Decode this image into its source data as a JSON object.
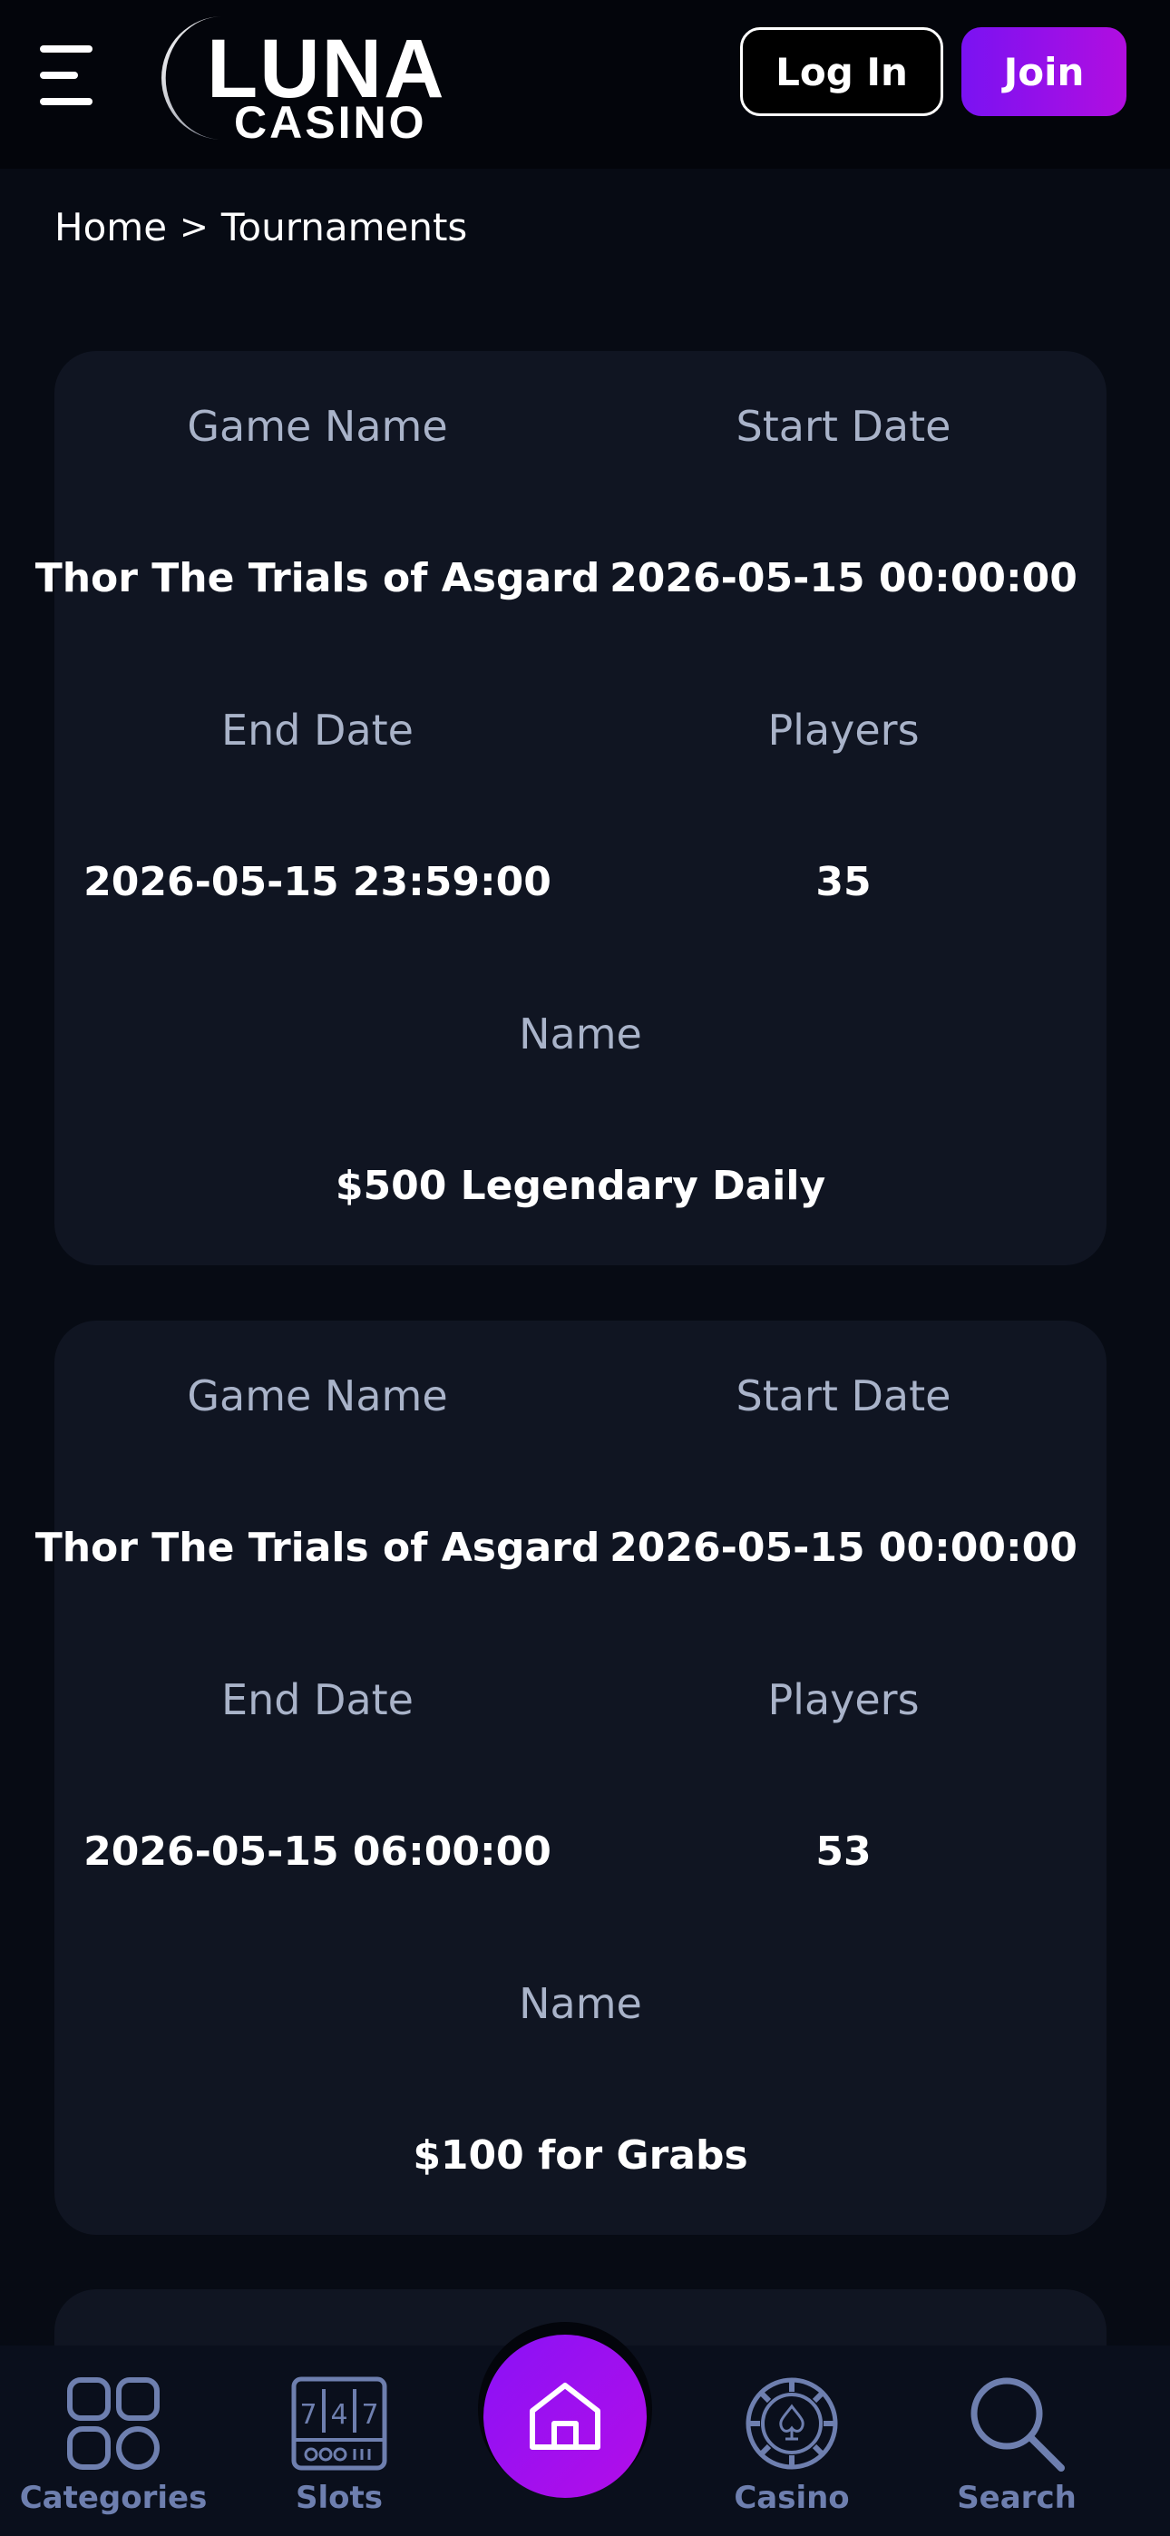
{
  "header": {
    "logo_word": "LUNA",
    "logo_sub": "CASINO",
    "login_label": "Log In",
    "join_label": "Join"
  },
  "breadcrumb": {
    "home": "Home",
    "separator": ">",
    "current": "Tournaments"
  },
  "labels": {
    "game_name": "Game Name",
    "start_date": "Start Date",
    "end_date": "End Date",
    "players": "Players",
    "name": "Name"
  },
  "tournaments": [
    {
      "game_name": "Thor The Trials of Asgard",
      "start_date": "2026-05-15 00:00:00",
      "end_date": "2026-05-15 23:59:00",
      "players": "35",
      "name": "$500 Legendary Daily"
    },
    {
      "game_name": "Thor The Trials of Asgard",
      "start_date": "2026-05-15 00:00:00",
      "end_date": "2026-05-15 06:00:00",
      "players": "53",
      "name": "$100 for Grabs"
    }
  ],
  "bottom_nav": {
    "items": [
      {
        "label": "Categories",
        "icon": "grid-icon"
      },
      {
        "label": "Slots",
        "icon": "slot-machine-icon"
      },
      {
        "label": "",
        "icon": "home-icon"
      },
      {
        "label": "Casino",
        "icon": "casino-chip-icon"
      },
      {
        "label": "Search",
        "icon": "search-icon"
      }
    ]
  },
  "colors": {
    "background": "#070b14",
    "header": "#03050b",
    "card": "#101522",
    "label": "#a9b3c9",
    "accent_purple": "#8a12f6",
    "nav_icon": "#6e7faf"
  }
}
